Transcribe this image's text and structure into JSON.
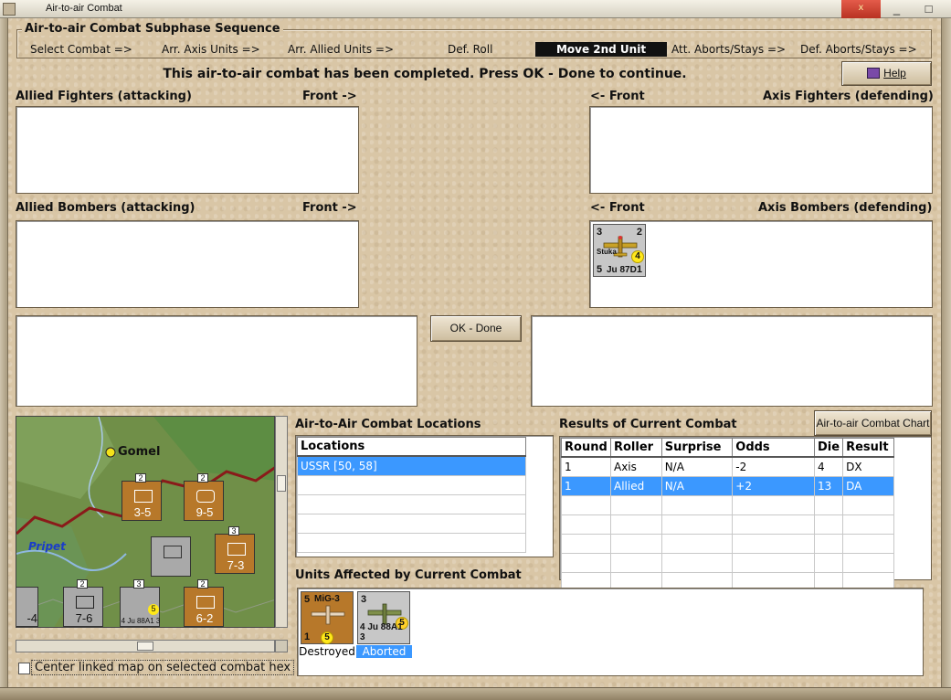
{
  "window": {
    "title": "Air-to-air Combat",
    "minimize": "_",
    "maximize": "□",
    "close": "x"
  },
  "sequence": {
    "title": "Air-to-air Combat Subphase Sequence",
    "steps": [
      "Select Combat =>",
      "Arr. Axis Units =>",
      "Arr. Allied Units =>",
      "Def. Roll",
      "Move 2nd Unit",
      "Att. Aborts/Stays =>",
      "Def. Aborts/Stays =>"
    ],
    "active_index": 4
  },
  "message": "This air-to-air combat has been completed.  Press OK - Done to continue.",
  "help_label": "Help",
  "panels": {
    "allied_fighters": "Allied Fighters (attacking)",
    "allied_fighters_front": "Front ->",
    "axis_fighters": "Axis Fighters (defending)",
    "axis_fighters_front": "<- Front",
    "allied_bombers": "Allied Bombers (attacking)",
    "allied_bombers_front": "Front ->",
    "axis_bombers": "Axis Bombers (defending)",
    "axis_bombers_front": "<- Front"
  },
  "axis_bomber_counter": {
    "top_left": "3",
    "top_right": "2",
    "bottom_left": "5",
    "bottom_right": "1",
    "type": "Stuka",
    "name": "Ju 87D",
    "badge": "4"
  },
  "ok_done_label": "OK - Done",
  "map": {
    "city": "Gomel",
    "river": "Pripet",
    "units": [
      {
        "value": "3-5",
        "flag": "2"
      },
      {
        "value": "9-5",
        "flag": "2"
      },
      {
        "value": "7-3",
        "flag": "3"
      },
      {
        "value": "7-6",
        "flag": "2"
      },
      {
        "value": "6-2",
        "flag": "2"
      },
      {
        "value": "-4",
        "flag": ""
      }
    ],
    "plane_counter": {
      "name": "4 Ju 88A1 3",
      "badge": "5",
      "flag": "3"
    }
  },
  "locations": {
    "title": "Air-to-Air Combat Locations",
    "header": "Locations",
    "rows": [
      "USSR [50, 58]",
      "",
      "",
      "",
      ""
    ]
  },
  "results": {
    "title": "Results of Current Combat",
    "chart_button": "Air-to-air Combat Chart",
    "headers": [
      "Round",
      "Roller",
      "Surprise",
      "Odds",
      "Die",
      "Result"
    ],
    "rows": [
      [
        "1",
        "Axis",
        "N/A",
        "-2",
        "4",
        "DX"
      ],
      [
        "1",
        "Allied",
        "N/A",
        "+2",
        "13",
        "DA"
      ]
    ],
    "empty_rows": 5,
    "selected_row": 1
  },
  "affected": {
    "title": "Units Affected by Current Combat",
    "units": [
      {
        "top_left": "5",
        "name_top": "MiG-3",
        "bottom_left": "1",
        "badge": "5",
        "status": "Destroyed"
      },
      {
        "top_left": "3",
        "name": "4 Ju 88A1 3",
        "badge": "5",
        "status": "Aborted"
      }
    ]
  },
  "center_linked": "Center linked map on selected combat hex",
  "colors": {
    "background": "#d9c6a6",
    "selection": "#3b98ff",
    "active_step": "#111111"
  }
}
